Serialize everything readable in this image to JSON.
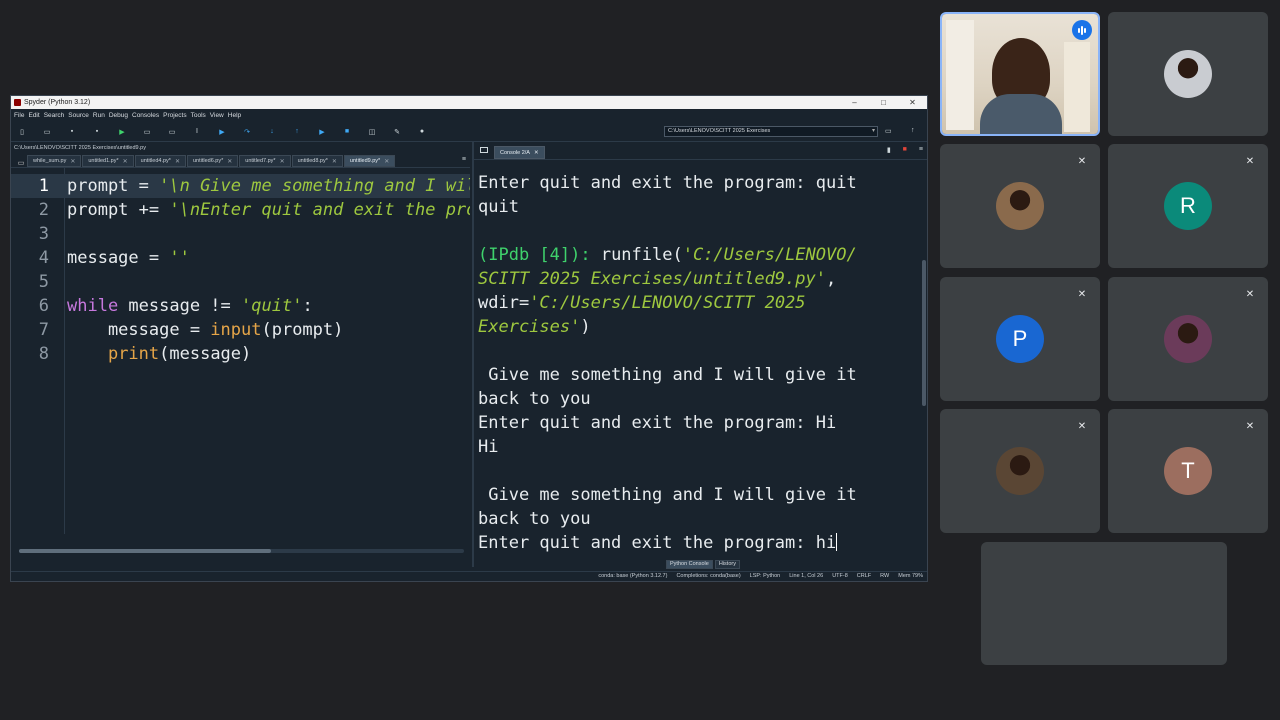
{
  "window": {
    "title": "Spyder (Python 3.12)",
    "controls": [
      "–",
      "□",
      "✕"
    ]
  },
  "menu": [
    "File",
    "Edit",
    "Search",
    "Source",
    "Run",
    "Debug",
    "Consoles",
    "Projects",
    "Tools",
    "View",
    "Help"
  ],
  "toolbar": {
    "working_dir": "C:\\Users\\LENOVO\\SCITT 2025 Exercises"
  },
  "editor": {
    "file_path": "C:\\Users\\LENOVO\\SCITT 2025 Exercises\\untitled9.py",
    "tabs": [
      {
        "label": "while_sum.py"
      },
      {
        "label": "untitled1.py*"
      },
      {
        "label": "untitled4.py*"
      },
      {
        "label": "untitled6.py*"
      },
      {
        "label": "untitled7.py*"
      },
      {
        "label": "untitled8.py*"
      },
      {
        "label": "untitled9.py*"
      }
    ],
    "active_tab": 6,
    "current_line": 1,
    "lines": [
      {
        "n": "1",
        "code": "prompt = '\\n Give me something and I will give it back to you'"
      },
      {
        "n": "2",
        "code": "prompt += '\\nEnter quit and exit the program: '"
      },
      {
        "n": "3",
        "code": ""
      },
      {
        "n": "4",
        "code": "message = ''"
      },
      {
        "n": "5",
        "code": ""
      },
      {
        "n": "6",
        "code": "while message != 'quit':"
      },
      {
        "n": "7",
        "code": "    message = input(prompt)"
      },
      {
        "n": "8",
        "code": "    print(message)"
      }
    ]
  },
  "console": {
    "tab_label": "Console 2/A",
    "output": [
      "Enter quit and exit the program: quit",
      "quit",
      "",
      "(IPdb [4]): runfile('C:/Users/LENOVO/",
      "SCITT 2025 Exercises/untitled9.py',",
      "wdir='C:/Users/LENOVO/SCITT 2025",
      "Exercises')",
      "",
      " Give me something and I will give it",
      "back to you",
      "Enter quit and exit the program: Hi",
      "Hi",
      "",
      " Give me something and I will give it",
      "back to you",
      "Enter quit and exit the program: hi"
    ],
    "bottom_tabs": [
      "Python Console",
      "History"
    ]
  },
  "statusbar": {
    "items": [
      "conda: base (Python 3.12.7)",
      "Completions: conda(base)",
      "LSP: Python",
      "Line 1, Col 26",
      "UTF-8",
      "CRLF",
      "RW",
      "Mem 79%"
    ]
  },
  "participants": [
    {
      "type": "video",
      "speaking": true
    },
    {
      "type": "photo",
      "muted": false,
      "color": "#c9ccd1"
    },
    {
      "type": "photo",
      "muted": true,
      "color": "#8a6a4c"
    },
    {
      "type": "initial",
      "initial": "R",
      "muted": true,
      "color": "#0b8a7a"
    },
    {
      "type": "initial",
      "initial": "P",
      "muted": true,
      "color": "#1967d2"
    },
    {
      "type": "photo",
      "muted": true,
      "color": "#6b3b5a"
    },
    {
      "type": "photo",
      "muted": true,
      "color": "#5a4634"
    },
    {
      "type": "initial",
      "initial": "T",
      "muted": true,
      "color": "#9c6e5f"
    }
  ]
}
